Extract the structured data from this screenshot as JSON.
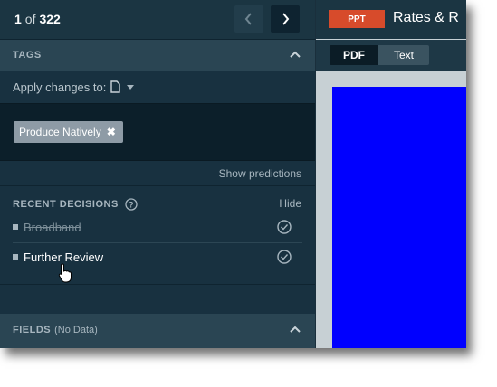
{
  "pager": {
    "current": "1",
    "of_label": "of",
    "total": "322"
  },
  "tags_section": {
    "title": "TAGS"
  },
  "apply_changes": {
    "label": "Apply changes to:"
  },
  "tag_chips": [
    {
      "label": "Produce Natively",
      "remove_icon": "close-icon"
    }
  ],
  "show_predictions": "Show predictions",
  "recent_decisions": {
    "title": "RECENT DECISIONS",
    "hide_label": "Hide",
    "items": [
      {
        "label": "Broadband",
        "struck": true
      },
      {
        "label": "Further Review",
        "struck": false
      }
    ]
  },
  "fields_section": {
    "title": "FIELDS",
    "subtitle": "(No Data)"
  },
  "document": {
    "type_badge": "PPT",
    "title": "Rates & R"
  },
  "view_toggle": {
    "pdf_label": "PDF",
    "text_label": "Text"
  },
  "colors": {
    "panel_bg": "#183140",
    "header_bg": "#2a4553",
    "ppt_badge": "#d74b2b",
    "preview_fill": "#0000ff",
    "chip_bg": "#8e9ba6"
  }
}
